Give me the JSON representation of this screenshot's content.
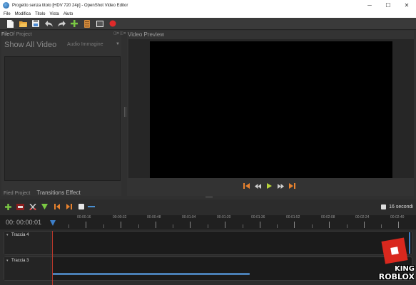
{
  "window": {
    "title": "Progetto senza titolo [HDV 720 24p] - OpenShot Video Editor",
    "controls": [
      "─",
      "☐",
      "✕"
    ]
  },
  "menu": [
    {
      "label": "File"
    },
    {
      "label": "Modifica"
    },
    {
      "label": "Titolo"
    },
    {
      "label": "Vista"
    },
    {
      "label": "Aiuto"
    }
  ],
  "toolbar_icons": [
    "new-project-icon",
    "open-project-icon",
    "save-project-icon",
    "undo-icon",
    "redo-icon",
    "import-files-icon",
    "choose-profile-icon",
    "fullscreen-icon",
    "export-video-icon"
  ],
  "files_panel": {
    "title_a": "File",
    "title_b": "Of Project",
    "filter_all": "Show All Video",
    "filter_other": "Audio Immagine",
    "tabs": [
      "Fied Project",
      "Transitions Effect"
    ]
  },
  "preview_panel": {
    "title": "Video Preview"
  },
  "playback_icons": [
    "jump-start-icon",
    "rewind-icon",
    "play-icon",
    "fast-forward-icon",
    "jump-end-icon"
  ],
  "timeline": {
    "timecode": "00: 00:00:01",
    "zoom_label": "16 secondi",
    "ticks": [
      "00:00:16",
      "00:00:32",
      "00:00:48",
      "00:01:04",
      "00:01:20",
      "00:01:36",
      "00:01:52",
      "00:02:08",
      "00:02:24",
      "00:02:40"
    ],
    "tracks": [
      {
        "name": "Traccia 4"
      },
      {
        "name": "Traccia 3"
      }
    ]
  },
  "watermark": {
    "line1": "KING",
    "line2": "ROBLOX"
  },
  "colors": {
    "accent_blue": "#3d7fc9",
    "playhead_red": "#c0392b",
    "add_green": "#7ac943",
    "marker_orange": "#e8822e"
  }
}
